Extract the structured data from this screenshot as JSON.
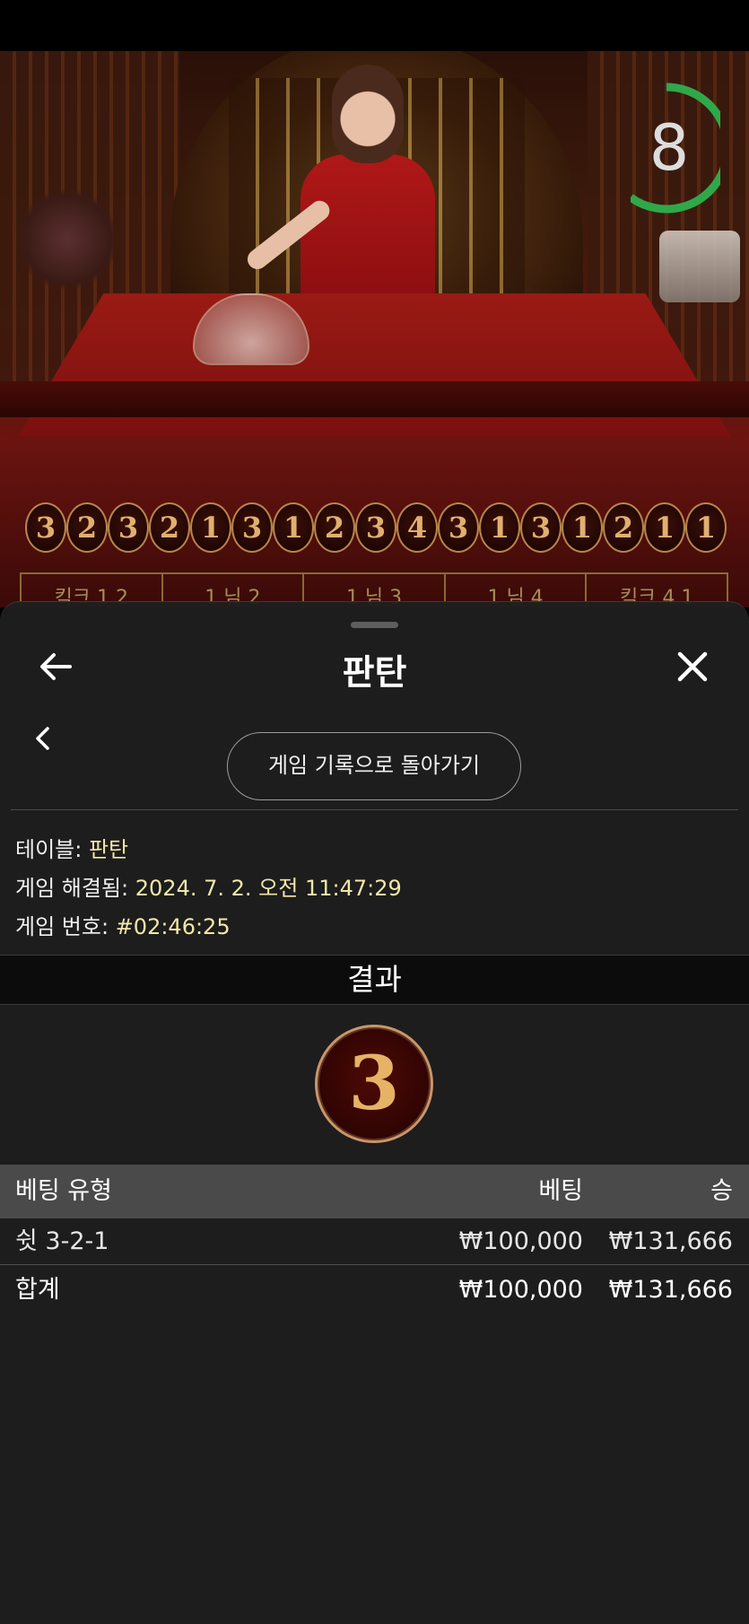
{
  "timer": {
    "value": "8",
    "progress": 0.6,
    "color": "#2fa84a"
  },
  "history": {
    "results": [
      "3",
      "2",
      "3",
      "2",
      "1",
      "3",
      "1",
      "2",
      "3",
      "4",
      "3",
      "1",
      "3",
      "1",
      "2",
      "1",
      "1"
    ]
  },
  "bet_grid_top": [
    "킥크 1 2",
    "1 님 2",
    "1 님 3",
    "1 님 4",
    "킥크 4 1"
  ],
  "sheet": {
    "title": "판탄",
    "back_icon": "arrow-left-icon",
    "close_icon": "close-icon",
    "prev_icon": "chevron-left-icon",
    "history_button": "게임 기록으로 돌아가기"
  },
  "info": {
    "table_label": "테이블:",
    "table_value": "판탄",
    "resolved_label": "게임 해결됨:",
    "resolved_value": "2024. 7. 2. 오전 11:47:29",
    "game_no_label": "게임 번호:",
    "game_no_value": "#02:46:25"
  },
  "result": {
    "heading": "결과",
    "value": "3"
  },
  "bets": {
    "columns": {
      "type": "베팅 유형",
      "bet": "베팅",
      "win": "승"
    },
    "rows": [
      {
        "type": "쉿 3-2-1",
        "bet": "₩100,000",
        "win": "₩131,666"
      }
    ],
    "total": {
      "label": "합계",
      "bet": "₩100,000",
      "win": "₩131,666"
    }
  },
  "colors": {
    "accent_text": "#f2e8a8",
    "gold": "#c9966a",
    "sheet_bg": "#1e1e1e"
  }
}
